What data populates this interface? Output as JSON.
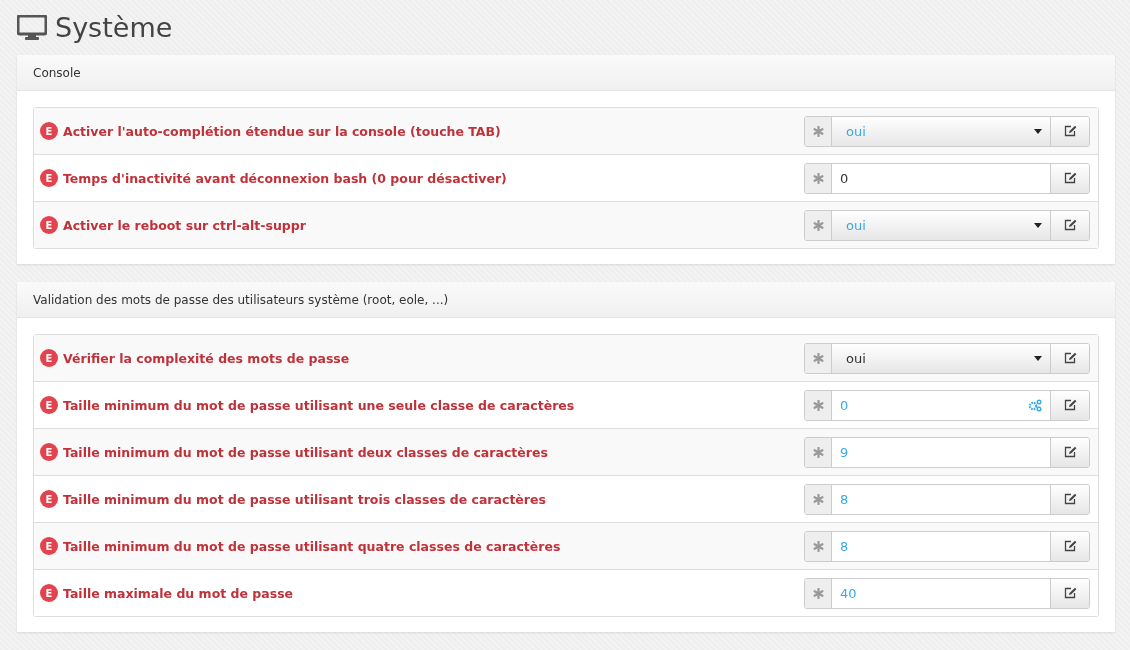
{
  "page": {
    "title": "Système"
  },
  "sections": [
    {
      "title": "Console",
      "rows": [
        {
          "badge": "E",
          "label": "Activer l'auto-complétion étendue sur la console (touche TAB)",
          "kind": "select",
          "value": "oui",
          "modified": false,
          "calculated": false
        },
        {
          "badge": "E",
          "label": "Temps d'inactivité avant déconnexion bash (0 pour désactiver)",
          "kind": "text",
          "value": "0",
          "modified": true,
          "calculated": false
        },
        {
          "badge": "E",
          "label": "Activer le reboot sur ctrl-alt-suppr",
          "kind": "select",
          "value": "oui",
          "modified": false,
          "calculated": false
        }
      ]
    },
    {
      "title": "Validation des mots de passe des utilisateurs système (root, eole, ...)",
      "rows": [
        {
          "badge": "E",
          "label": "Vérifier la complexité des mots de passe",
          "kind": "select",
          "value": "oui",
          "modified": true,
          "calculated": false
        },
        {
          "badge": "E",
          "label": "Taille minimum du mot de passe utilisant une seule classe de caractères",
          "kind": "text",
          "value": "0",
          "modified": false,
          "calculated": true
        },
        {
          "badge": "E",
          "label": "Taille minimum du mot de passe utilisant deux classes de caractères",
          "kind": "text",
          "value": "9",
          "modified": false,
          "calculated": false
        },
        {
          "badge": "E",
          "label": "Taille minimum du mot de passe utilisant trois classes de caractères",
          "kind": "text",
          "value": "8",
          "modified": false,
          "calculated": false
        },
        {
          "badge": "E",
          "label": "Taille minimum du mot de passe utilisant quatre classes de caractères",
          "kind": "text",
          "value": "8",
          "modified": false,
          "calculated": false
        },
        {
          "badge": "E",
          "label": "Taille maximale du mot de passe",
          "kind": "text",
          "value": "40",
          "modified": false,
          "calculated": false
        }
      ]
    }
  ]
}
